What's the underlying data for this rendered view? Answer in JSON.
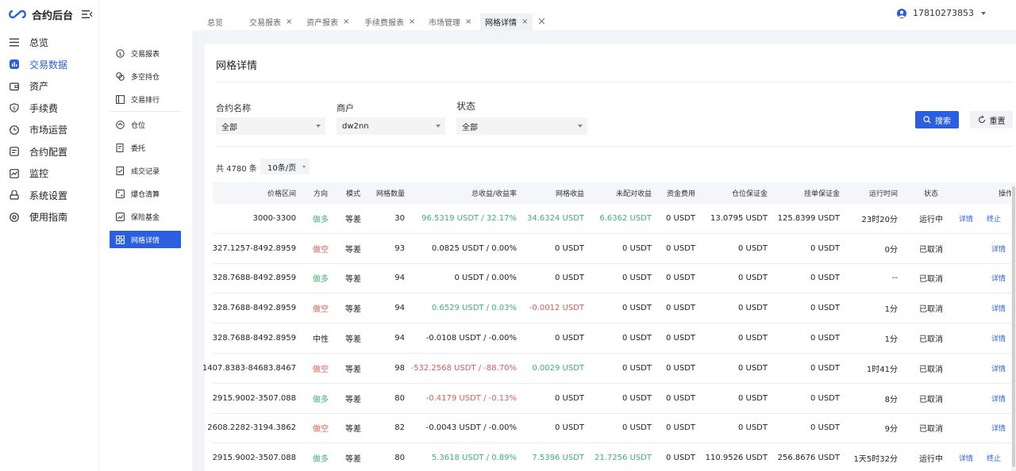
{
  "app": {
    "title": "合约后台"
  },
  "sidebar": {
    "items": [
      {
        "label": "总览",
        "icon": "list-icon"
      },
      {
        "label": "交易数据",
        "icon": "chart-icon",
        "active": true
      },
      {
        "label": "资产",
        "icon": "wallet-icon"
      },
      {
        "label": "手续费",
        "icon": "dollar-icon"
      },
      {
        "label": "市场运营",
        "icon": "clock-icon"
      },
      {
        "label": "合约配置",
        "icon": "doc-icon"
      },
      {
        "label": "监控",
        "icon": "monitor-icon"
      },
      {
        "label": "系统设置",
        "icon": "settings-icon"
      },
      {
        "label": "使用指南",
        "icon": "guide-icon"
      }
    ]
  },
  "subnav": {
    "items": [
      {
        "label": "交易报表"
      },
      {
        "label": "多空持仓"
      },
      {
        "label": "交易排行"
      },
      {
        "label": "仓位"
      },
      {
        "label": "委托"
      },
      {
        "label": "成交记录"
      },
      {
        "label": "爆仓清算"
      },
      {
        "label": "保险基金"
      },
      {
        "label": "网格详情",
        "active": true
      }
    ]
  },
  "tabs": [
    {
      "label": "总览",
      "closable": false
    },
    {
      "label": "交易报表",
      "closable": true
    },
    {
      "label": "资产报表",
      "closable": true
    },
    {
      "label": "手续费报表",
      "closable": true
    },
    {
      "label": "市场管理",
      "closable": true
    },
    {
      "label": "网格详情",
      "closable": true,
      "active": true
    }
  ],
  "user": {
    "phone": "17810273853"
  },
  "page": {
    "title": "网格详情"
  },
  "filters": {
    "contract": {
      "label": "合约名称",
      "value": "全部"
    },
    "merchant": {
      "label": "商户",
      "value": "dw2nn"
    },
    "status": {
      "label": "状态",
      "value": "全部"
    },
    "search_label": "搜索",
    "reset_label": "重置"
  },
  "pagination": {
    "total_text": "共 4780 条",
    "page_size": "10条/页"
  },
  "table": {
    "headers": {
      "range": "价格区间",
      "dir": "方向",
      "mode": "模式",
      "grids": "网格数量",
      "total": "总收益/收益率",
      "grid_profit": "网格收益",
      "unpaired": "未配对收益",
      "funding": "资金费用",
      "margin": "仓位保证金",
      "order_margin": "挂单保证金",
      "runtime": "运行时间",
      "status": "状态",
      "ops": "操作"
    },
    "detail_label": "详情",
    "stop_label": "终止",
    "rows": [
      {
        "range": "3000-3300",
        "dir": "做多",
        "mode": "等差",
        "grids": "30",
        "total": "96.5319 USDT / 32.17%",
        "grid_profit": "34.6324 USDT",
        "unpaired": "6.6362 USDT",
        "funding": "0 USDT",
        "margin": "13.0795 USDT",
        "order_margin": "125.8399 USDT",
        "runtime": "23时20分",
        "status": "运行中",
        "stoppable": true,
        "dir_color": "green",
        "total_color": "green",
        "gp_color": "green",
        "up_color": "green"
      },
      {
        "range": "327.1257-8492.8959",
        "dir": "做空",
        "mode": "等差",
        "grids": "93",
        "total": "0.0825 USDT / 0.00%",
        "grid_profit": "0 USDT",
        "unpaired": "0 USDT",
        "funding": "0 USDT",
        "margin": "0 USDT",
        "order_margin": "0 USDT",
        "runtime": "0分",
        "status": "已取消",
        "stoppable": false,
        "dir_color": "red",
        "total_color": "",
        "gp_color": "",
        "up_color": ""
      },
      {
        "range": "328.7688-8492.8959",
        "dir": "做多",
        "mode": "等差",
        "grids": "94",
        "total": "0 USDT / 0.00%",
        "grid_profit": "0 USDT",
        "unpaired": "0 USDT",
        "funding": "0 USDT",
        "margin": "0 USDT",
        "order_margin": "0 USDT",
        "runtime": "--",
        "status": "已取消",
        "stoppable": false,
        "dir_color": "green",
        "total_color": "",
        "gp_color": "",
        "up_color": ""
      },
      {
        "range": "328.7688-8492.8959",
        "dir": "做空",
        "mode": "等差",
        "grids": "94",
        "total": "0.6529 USDT / 0.03%",
        "grid_profit": "-0.0012 USDT",
        "unpaired": "0 USDT",
        "funding": "0 USDT",
        "margin": "0 USDT",
        "order_margin": "0 USDT",
        "runtime": "1分",
        "status": "已取消",
        "stoppable": false,
        "dir_color": "red",
        "total_color": "green",
        "gp_color": "red",
        "up_color": ""
      },
      {
        "range": "328.7688-8492.8959",
        "dir": "中性",
        "mode": "等差",
        "grids": "94",
        "total": "-0.0108 USDT / -0.00%",
        "grid_profit": "0 USDT",
        "unpaired": "0 USDT",
        "funding": "0 USDT",
        "margin": "0 USDT",
        "order_margin": "0 USDT",
        "runtime": "1分",
        "status": "已取消",
        "stoppable": false,
        "dir_color": "",
        "total_color": "",
        "gp_color": "",
        "up_color": ""
      },
      {
        "range": "1407.8383-84683.8467",
        "dir": "做空",
        "mode": "等差",
        "grids": "98",
        "total": "-532.2568 USDT / -88.70%",
        "grid_profit": "0.0029 USDT",
        "unpaired": "0 USDT",
        "funding": "0 USDT",
        "margin": "0 USDT",
        "order_margin": "0 USDT",
        "runtime": "1时41分",
        "status": "已取消",
        "stoppable": false,
        "dir_color": "red",
        "total_color": "red",
        "gp_color": "green",
        "up_color": ""
      },
      {
        "range": "2915.9002-3507.088",
        "dir": "做多",
        "mode": "等差",
        "grids": "80",
        "total": "-0.4179 USDT / -0.13%",
        "grid_profit": "0 USDT",
        "unpaired": "0 USDT",
        "funding": "0 USDT",
        "margin": "0 USDT",
        "order_margin": "0 USDT",
        "runtime": "8分",
        "status": "已取消",
        "stoppable": false,
        "dir_color": "green",
        "total_color": "red",
        "gp_color": "",
        "up_color": ""
      },
      {
        "range": "2608.2282-3194.3862",
        "dir": "做空",
        "mode": "等差",
        "grids": "82",
        "total": "-0.0043 USDT / -0.00%",
        "grid_profit": "0 USDT",
        "unpaired": "0 USDT",
        "funding": "0 USDT",
        "margin": "0 USDT",
        "order_margin": "0 USDT",
        "runtime": "9分",
        "status": "已取消",
        "stoppable": false,
        "dir_color": "red",
        "total_color": "",
        "gp_color": "",
        "up_color": ""
      },
      {
        "range": "2915.9002-3507.088",
        "dir": "做多",
        "mode": "等差",
        "grids": "80",
        "total": "5.3618 USDT / 0.89%",
        "grid_profit": "7.5396 USDT",
        "unpaired": "21.7256 USDT",
        "funding": "0 USDT",
        "margin": "110.9526 USDT",
        "order_margin": "256.8676 USDT",
        "runtime": "1天5时32分",
        "status": "运行中",
        "stoppable": true,
        "dir_color": "green",
        "total_color": "green",
        "gp_color": "green",
        "up_color": "green"
      }
    ]
  },
  "colors": {
    "accent": "#2b5fe0",
    "positive": "#3cb371",
    "negative": "#e05a5a"
  }
}
